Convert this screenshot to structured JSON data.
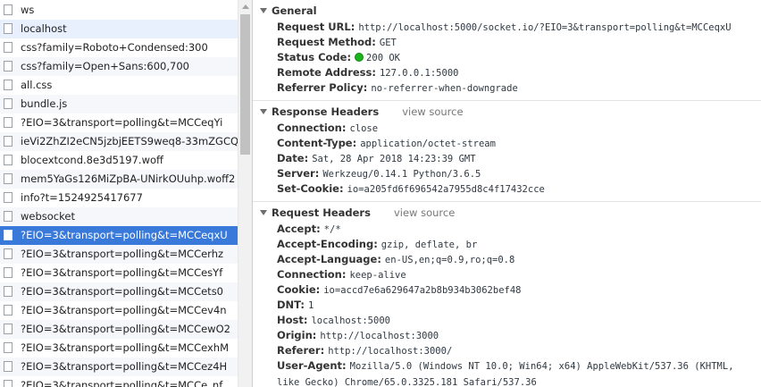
{
  "requests": [
    {
      "name": "ws",
      "state": ""
    },
    {
      "name": "localhost",
      "state": "sel"
    },
    {
      "name": "css?family=Roboto+Condensed:300",
      "state": ""
    },
    {
      "name": "css?family=Open+Sans:600,700",
      "state": ""
    },
    {
      "name": "all.css",
      "state": ""
    },
    {
      "name": "bundle.js",
      "state": ""
    },
    {
      "name": "?EIO=3&transport=polling&t=MCCeqYi",
      "state": ""
    },
    {
      "name": "ieVi2ZhZI2eCN5jzbjEETS9weq8-33mZGCQYbv",
      "state": ""
    },
    {
      "name": "blocextcond.8e3d5197.woff",
      "state": ""
    },
    {
      "name": "mem5YaGs126MiZpBA-UNirkOUuhp.woff2",
      "state": ""
    },
    {
      "name": "info?t=1524925417677",
      "state": ""
    },
    {
      "name": "websocket",
      "state": ""
    },
    {
      "name": "?EIO=3&transport=polling&t=MCCeqxU",
      "state": "cur"
    },
    {
      "name": "?EIO=3&transport=polling&t=MCCerhz",
      "state": ""
    },
    {
      "name": "?EIO=3&transport=polling&t=MCCesYf",
      "state": ""
    },
    {
      "name": "?EIO=3&transport=polling&t=MCCets0",
      "state": ""
    },
    {
      "name": "?EIO=3&transport=polling&t=MCCev4n",
      "state": ""
    },
    {
      "name": "?EIO=3&transport=polling&t=MCCewO2",
      "state": ""
    },
    {
      "name": "?EIO=3&transport=polling&t=MCCexhM",
      "state": ""
    },
    {
      "name": "?EIO=3&transport=polling&t=MCCez4H",
      "state": ""
    },
    {
      "name": "?EIO=3&transport=polling&t=MCCe_nf",
      "state": ""
    }
  ],
  "general": {
    "title": "General",
    "rows": [
      {
        "key": "Request URL:",
        "value": "http://localhost:5000/socket.io/?EIO=3&transport=polling&t=MCCeqxU"
      },
      {
        "key": "Request Method:",
        "value": "GET"
      },
      {
        "key": "Status Code:",
        "value": "200 OK",
        "status": true
      },
      {
        "key": "Remote Address:",
        "value": "127.0.0.1:5000"
      },
      {
        "key": "Referrer Policy:",
        "value": "no-referrer-when-downgrade"
      }
    ]
  },
  "response_headers": {
    "title": "Response Headers",
    "view_source": "view source",
    "rows": [
      {
        "key": "Connection:",
        "value": "close"
      },
      {
        "key": "Content-Type:",
        "value": "application/octet-stream"
      },
      {
        "key": "Date:",
        "value": "Sat, 28 Apr 2018 14:23:39 GMT"
      },
      {
        "key": "Server:",
        "value": "Werkzeug/0.14.1 Python/3.6.5"
      },
      {
        "key": "Set-Cookie:",
        "value": "io=a205fd6f696542a7955d8c4f17432cce"
      }
    ]
  },
  "request_headers": {
    "title": "Request Headers",
    "view_source": "view source",
    "rows": [
      {
        "key": "Accept:",
        "value": "*/*"
      },
      {
        "key": "Accept-Encoding:",
        "value": "gzip, deflate, br"
      },
      {
        "key": "Accept-Language:",
        "value": "en-US,en;q=0.9,ro;q=0.8"
      },
      {
        "key": "Connection:",
        "value": "keep-alive"
      },
      {
        "key": "Cookie:",
        "value": "io=accd7e6a629647a2b8b934b3062bef48"
      },
      {
        "key": "DNT:",
        "value": "1"
      },
      {
        "key": "Host:",
        "value": "localhost:5000"
      },
      {
        "key": "Origin:",
        "value": "http://localhost:3000"
      },
      {
        "key": "Referer:",
        "value": "http://localhost:3000/"
      },
      {
        "key": "User-Agent:",
        "value": "Mozilla/5.0 (Windows NT 10.0; Win64; x64) AppleWebKit/537.36 (KHTML, like Gecko) Chrome/65.0.3325.181 Safari/537.36",
        "wrap": true
      }
    ]
  },
  "colors": {
    "selected_row": "#3879d9",
    "status_ok": "#1bb51b"
  }
}
